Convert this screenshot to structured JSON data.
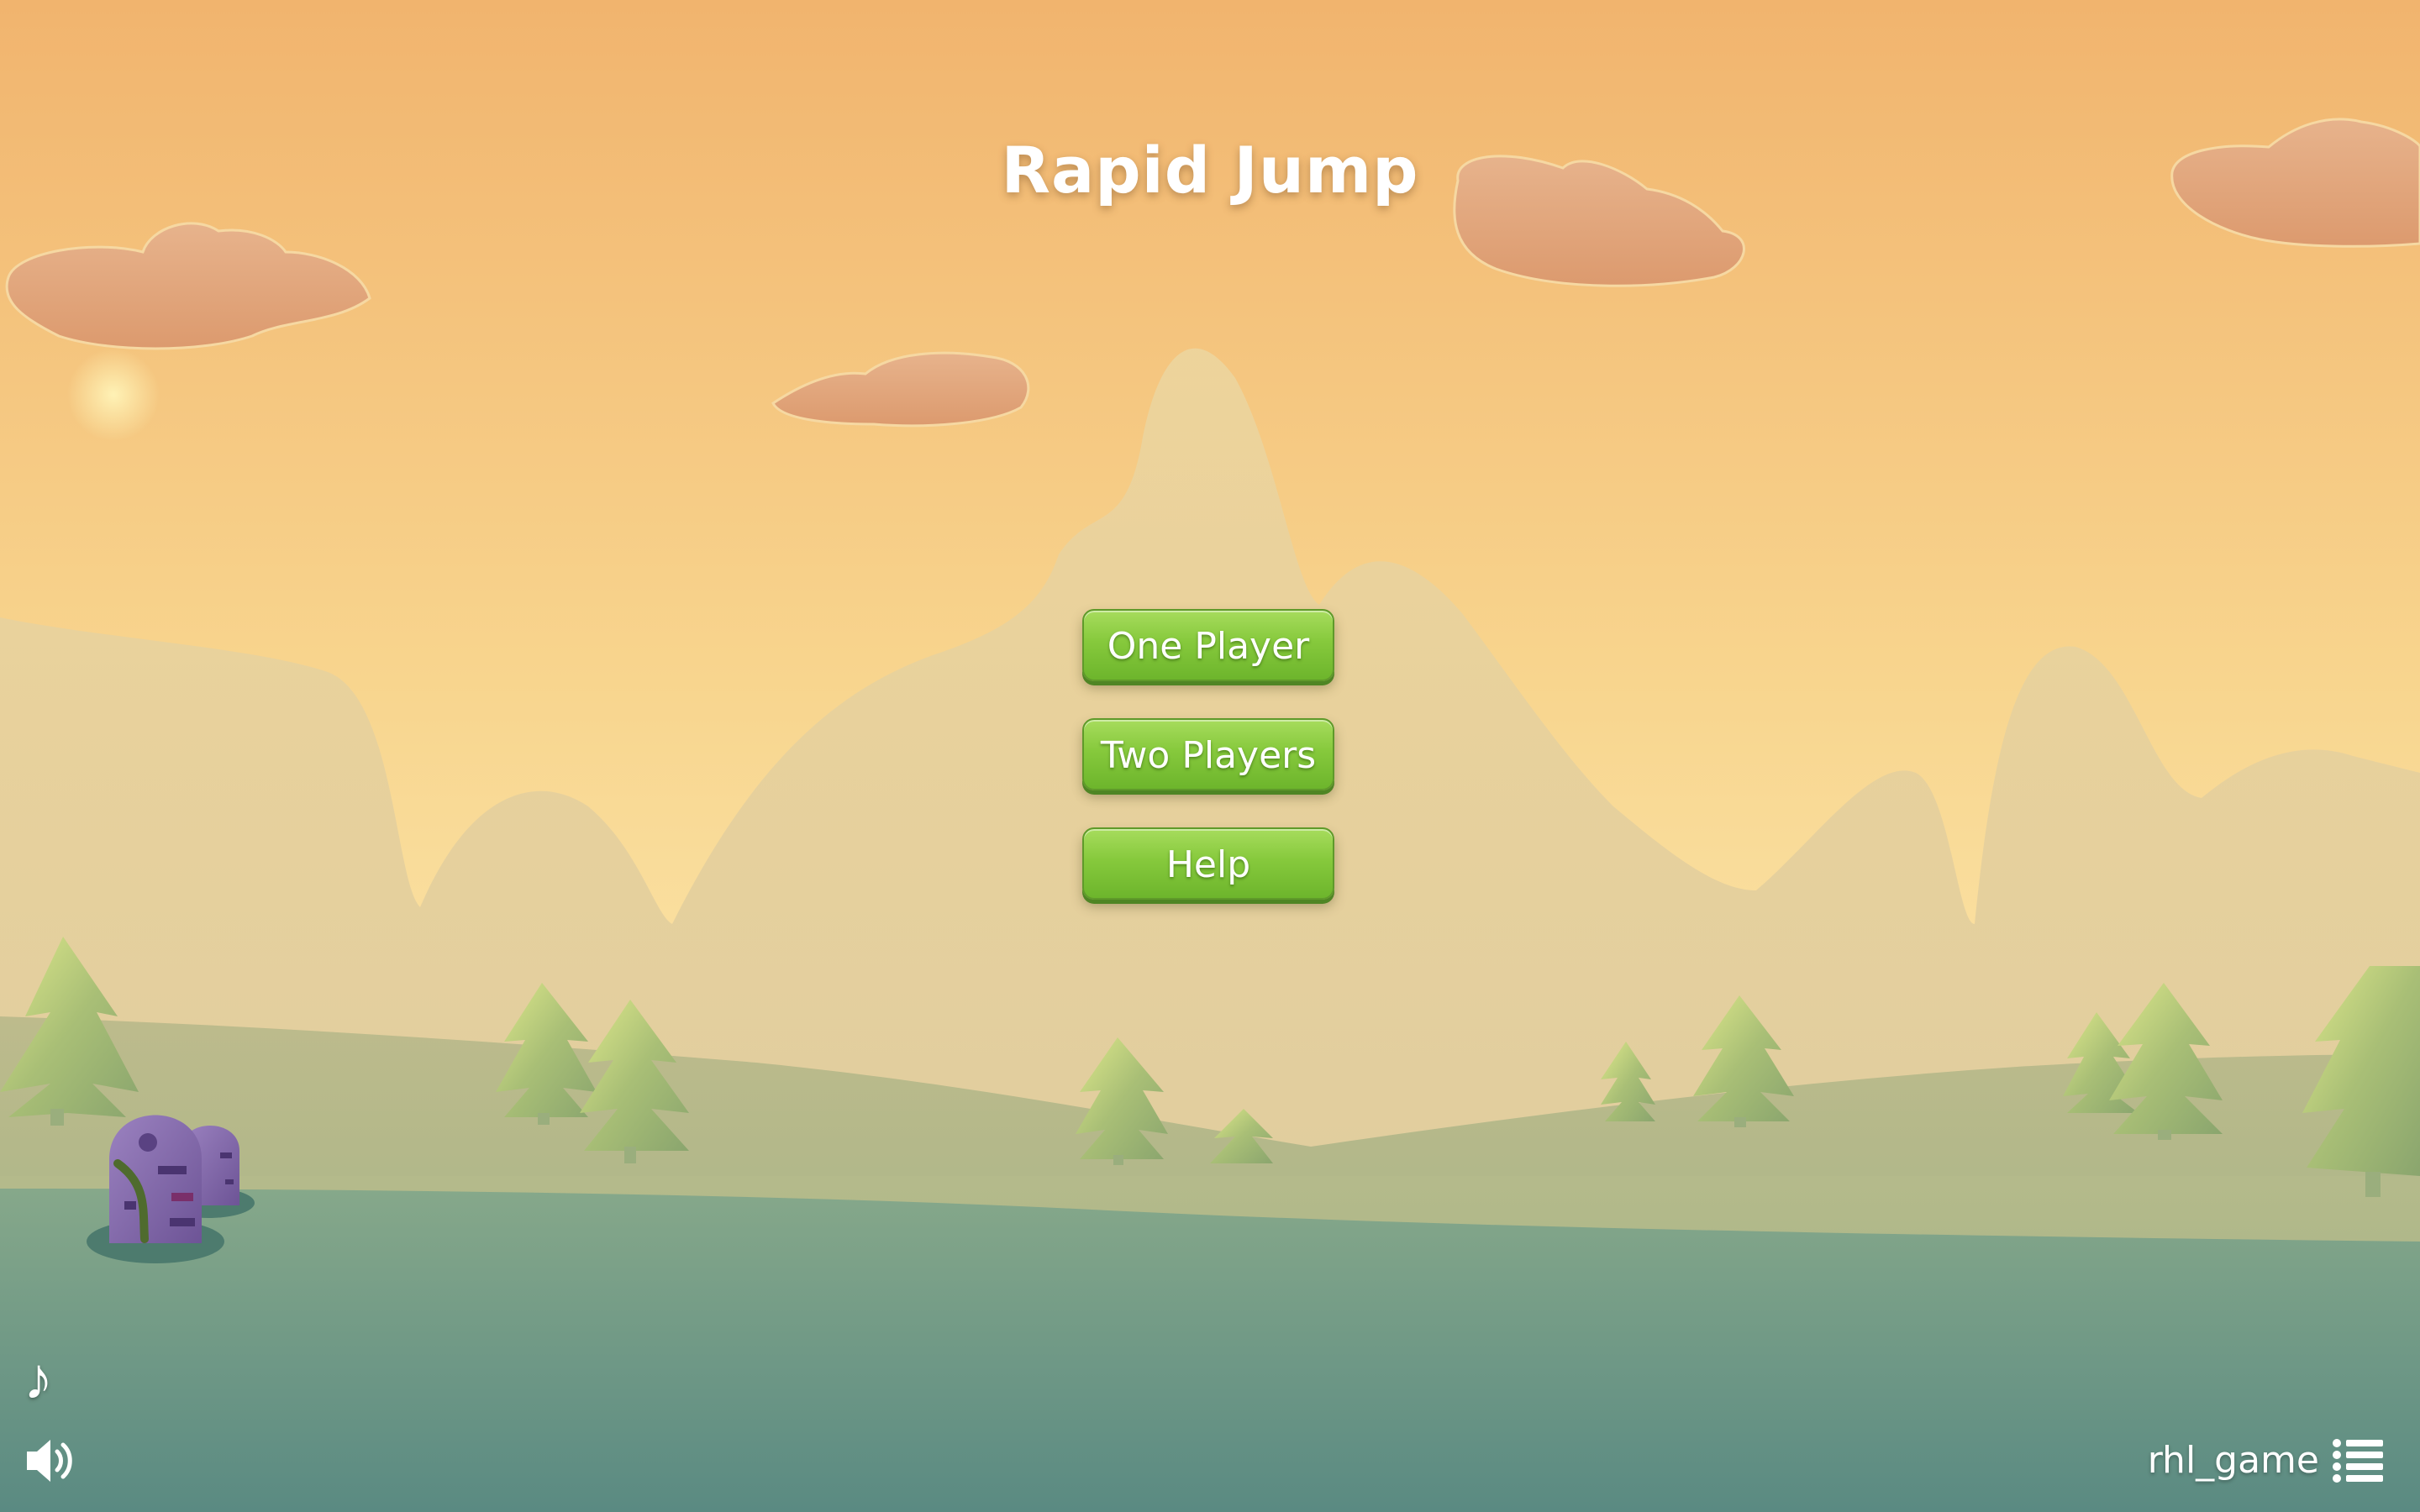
{
  "game": {
    "title": "Rapid Jump"
  },
  "menu": {
    "buttons": [
      {
        "label": "One Player"
      },
      {
        "label": "Two Players"
      },
      {
        "label": "Help"
      }
    ]
  },
  "footer": {
    "music_icon": "music-note-icon",
    "sound_icon": "speaker-volume-icon",
    "username": "rhl_game",
    "menu_icon": "list-menu-icon"
  },
  "colors": {
    "sky_top": "#f1b46e",
    "sky_bottom": "#fbe3a6",
    "button_green": "#86c93c",
    "ground_teal": "#5e8e85"
  }
}
